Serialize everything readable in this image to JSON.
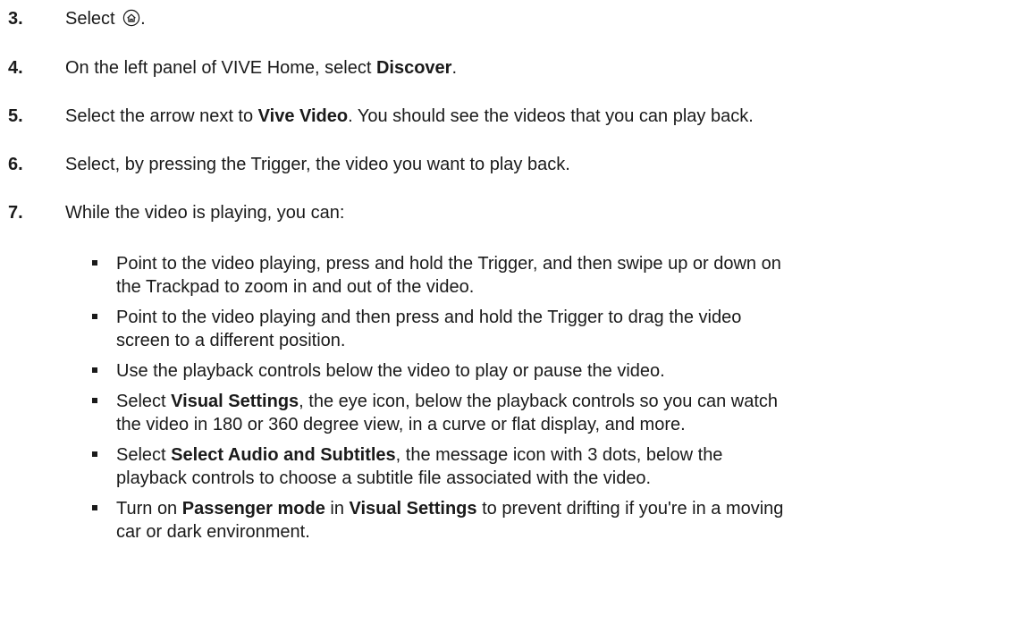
{
  "steps": [
    {
      "num": "3.",
      "prefix": "Select ",
      "icon": "home-icon",
      "suffix": "."
    },
    {
      "num": "4.",
      "prefix": "On the left panel of VIVE Home, select ",
      "bold": "Discover",
      "suffix": "."
    },
    {
      "num": "5.",
      "prefix": "Select the arrow next to ",
      "bold": "Vive Video",
      "suffix": ". You should see the videos that you can play back."
    },
    {
      "num": "6.",
      "text": "Select, by pressing the Trigger, the video you want to play back."
    },
    {
      "num": "7.",
      "text": "While the video is playing, you can:"
    }
  ],
  "bullets": [
    {
      "line1": "Point to the video playing, press and hold the Trigger, and then swipe up or down on",
      "line2": "the Trackpad to zoom in and out of the video."
    },
    {
      "line1": "Point to the video playing and then press and hold the Trigger to drag the video",
      "line2": "screen to a different position."
    },
    {
      "line1": "Use the playback controls below the video to play or pause the video."
    },
    {
      "pre": "Select ",
      "bold": "Visual Settings",
      "post": ", the eye icon, below the playback controls so you can watch",
      "line2": "the video in 180 or 360 degree view, in a curve or flat display, and more."
    },
    {
      "pre": "Select ",
      "bold": "Select Audio and Subtitles",
      "post": ", the message icon with 3 dots, below the",
      "line2": "playback controls to choose a subtitle file associated with the video."
    },
    {
      "pre": "Turn on ",
      "bold": "Passenger mode",
      "mid": " in ",
      "bold2": "Visual Settings",
      "post": " to prevent drifting if you're in a moving",
      "line2": "car or dark environment."
    }
  ]
}
